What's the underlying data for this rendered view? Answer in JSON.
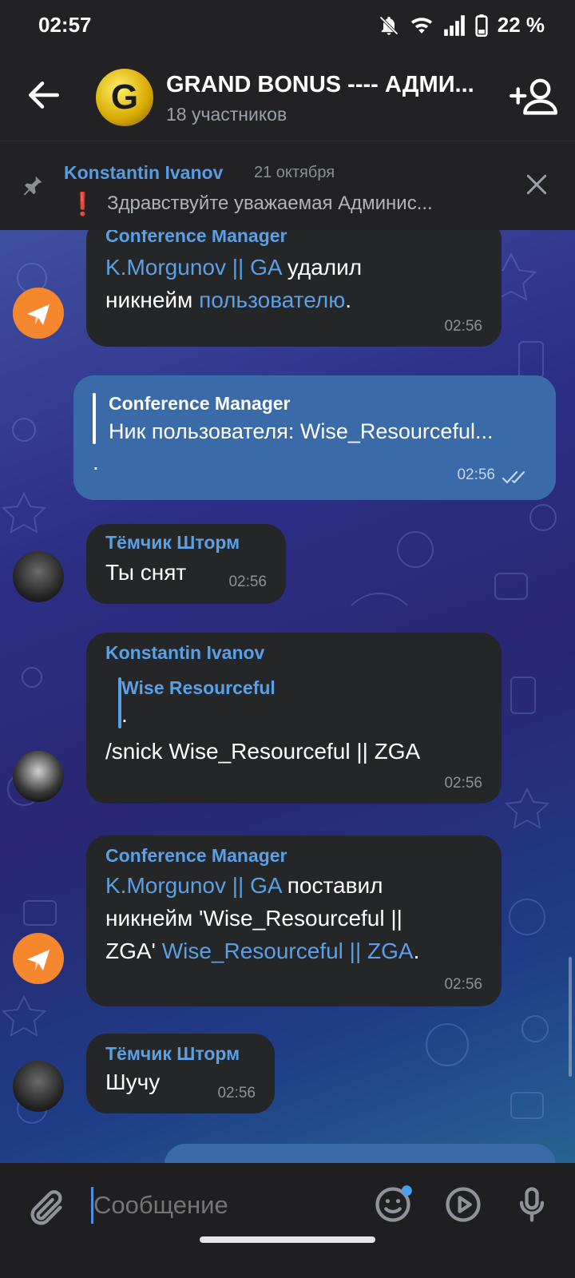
{
  "status": {
    "time": "02:57",
    "battery": "22 %"
  },
  "header": {
    "title": "GRAND BONUS ---- АДМИ...",
    "subtitle": "18 участников",
    "avatar_letter": "G"
  },
  "pinned": {
    "author": "Konstantin Ivanov",
    "date": "21 октября",
    "text": "Здравствуйте уважаемая Админис..."
  },
  "messages": {
    "m1": {
      "sender": "Conference Manager",
      "t1": "K.Morgunov || GA",
      "t2": " удалил",
      "t3": "никнейм ",
      "t4": "пользователю",
      "t5": ".",
      "time": "02:56"
    },
    "m2": {
      "sender": "Conference Manager",
      "quote": "Ник пользователя: Wise_Resourceful...",
      "text": ".",
      "time": "02:56"
    },
    "m3": {
      "sender": "Тёмчик Шторм",
      "text": "Ты снят",
      "time": "02:56"
    },
    "m4": {
      "sender": "Konstantin Ivanov",
      "reply_name": "Wise Resourceful",
      "reply_text": ".",
      "text": "/snick Wise_Resourceful || ZGA",
      "time": "02:56"
    },
    "m5": {
      "sender": "Conference Manager",
      "t1": "K.Morgunov || GA",
      "t2": " поставил",
      "t3": "никнейм 'Wise_Resourceful ||",
      "t4": "ZGA' ",
      "t5": "Wise_Resourceful || ZGA",
      "t6": ".",
      "time": "02:56"
    },
    "m6": {
      "sender": "Тёмчик Шторм",
      "text": "Шучу",
      "time": "02:56"
    }
  },
  "composer": {
    "placeholder": "Сообщение"
  }
}
